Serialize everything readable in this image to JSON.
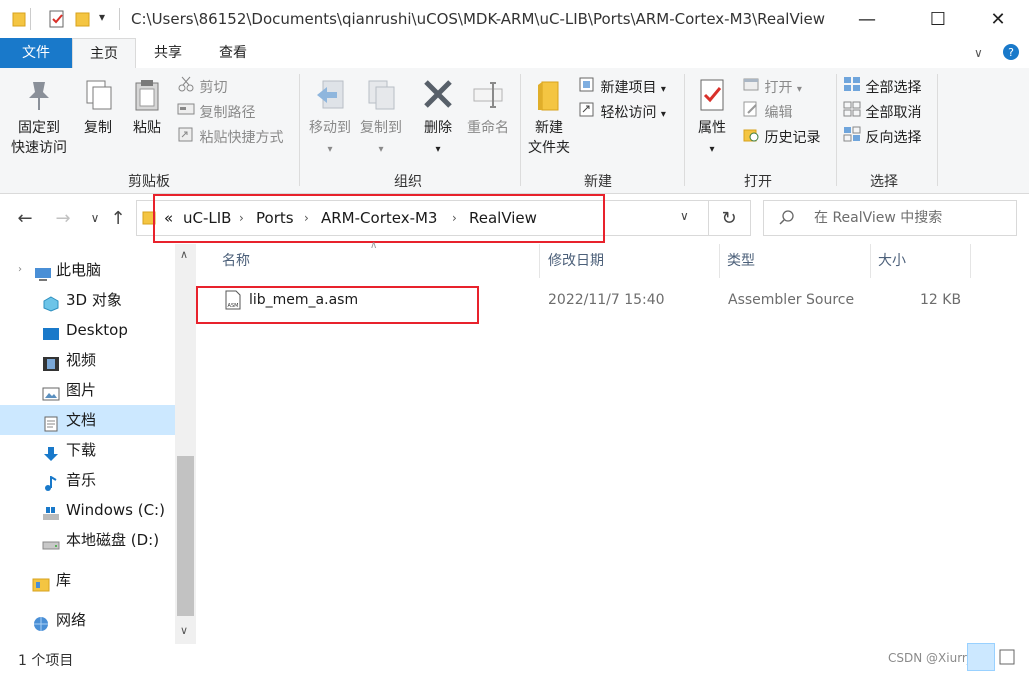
{
  "window": {
    "title_path": "C:\\Users\\86152\\Documents\\qianrushi\\uCOS\\MDK-ARM\\uC-LIB\\Ports\\ARM-Cortex-M3\\RealView",
    "qat_dropdown": "▾",
    "minimize": "—",
    "maximize": "☐",
    "close": "✕"
  },
  "tabs": [
    {
      "label": "文件"
    },
    {
      "label": "主页"
    },
    {
      "label": "共享"
    },
    {
      "label": "查看"
    }
  ],
  "ribbon": {
    "clipboard": {
      "group_label": "剪贴板",
      "pin_line1": "固定到",
      "pin_line2": "快速访问",
      "copy": "复制",
      "paste": "粘贴",
      "cut": "剪切",
      "copy_path": "复制路径",
      "paste_shortcut": "粘贴快捷方式"
    },
    "organize": {
      "group_label": "组织",
      "move_to": "移动到",
      "copy_to": "复制到",
      "delete": "删除",
      "rename": "重命名"
    },
    "new": {
      "group_label": "新建",
      "new_folder_line1": "新建",
      "new_folder_line2": "文件夹",
      "new_item": "新建项目",
      "easy_access": "轻松访问"
    },
    "open": {
      "group_label": "打开",
      "properties": "属性",
      "open": "打开",
      "edit": "编辑",
      "history": "历史记录"
    },
    "select": {
      "group_label": "选择",
      "select_all": "全部选择",
      "select_none": "全部取消",
      "invert": "反向选择"
    }
  },
  "address": {
    "overflow": "«",
    "crumbs": [
      "uC-LIB",
      "Ports",
      "ARM-Cortex-M3",
      "RealView"
    ],
    "search_placeholder": "在 RealView 中搜索"
  },
  "sidebar": {
    "items": [
      {
        "label": "此电脑"
      },
      {
        "label": "3D 对象"
      },
      {
        "label": "Desktop"
      },
      {
        "label": "视频"
      },
      {
        "label": "图片"
      },
      {
        "label": "文档"
      },
      {
        "label": "下载"
      },
      {
        "label": "音乐"
      },
      {
        "label": "Windows (C:)"
      },
      {
        "label": "本地磁盘 (D:)"
      },
      {
        "label": "库"
      },
      {
        "label": "网络"
      }
    ]
  },
  "table": {
    "columns": [
      "名称",
      "修改日期",
      "类型",
      "大小"
    ],
    "rows": [
      {
        "name": "lib_mem_a.asm",
        "modified": "2022/11/7 15:40",
        "type": "Assembler Source",
        "size": "12 KB"
      }
    ]
  },
  "status": {
    "count": "1 个项目",
    "watermark": "CSDN @Xiurr_S"
  },
  "colors": {
    "accent": "#1979ca",
    "highlight_box": "#e8222c",
    "selected_nav": "#cce8ff"
  }
}
